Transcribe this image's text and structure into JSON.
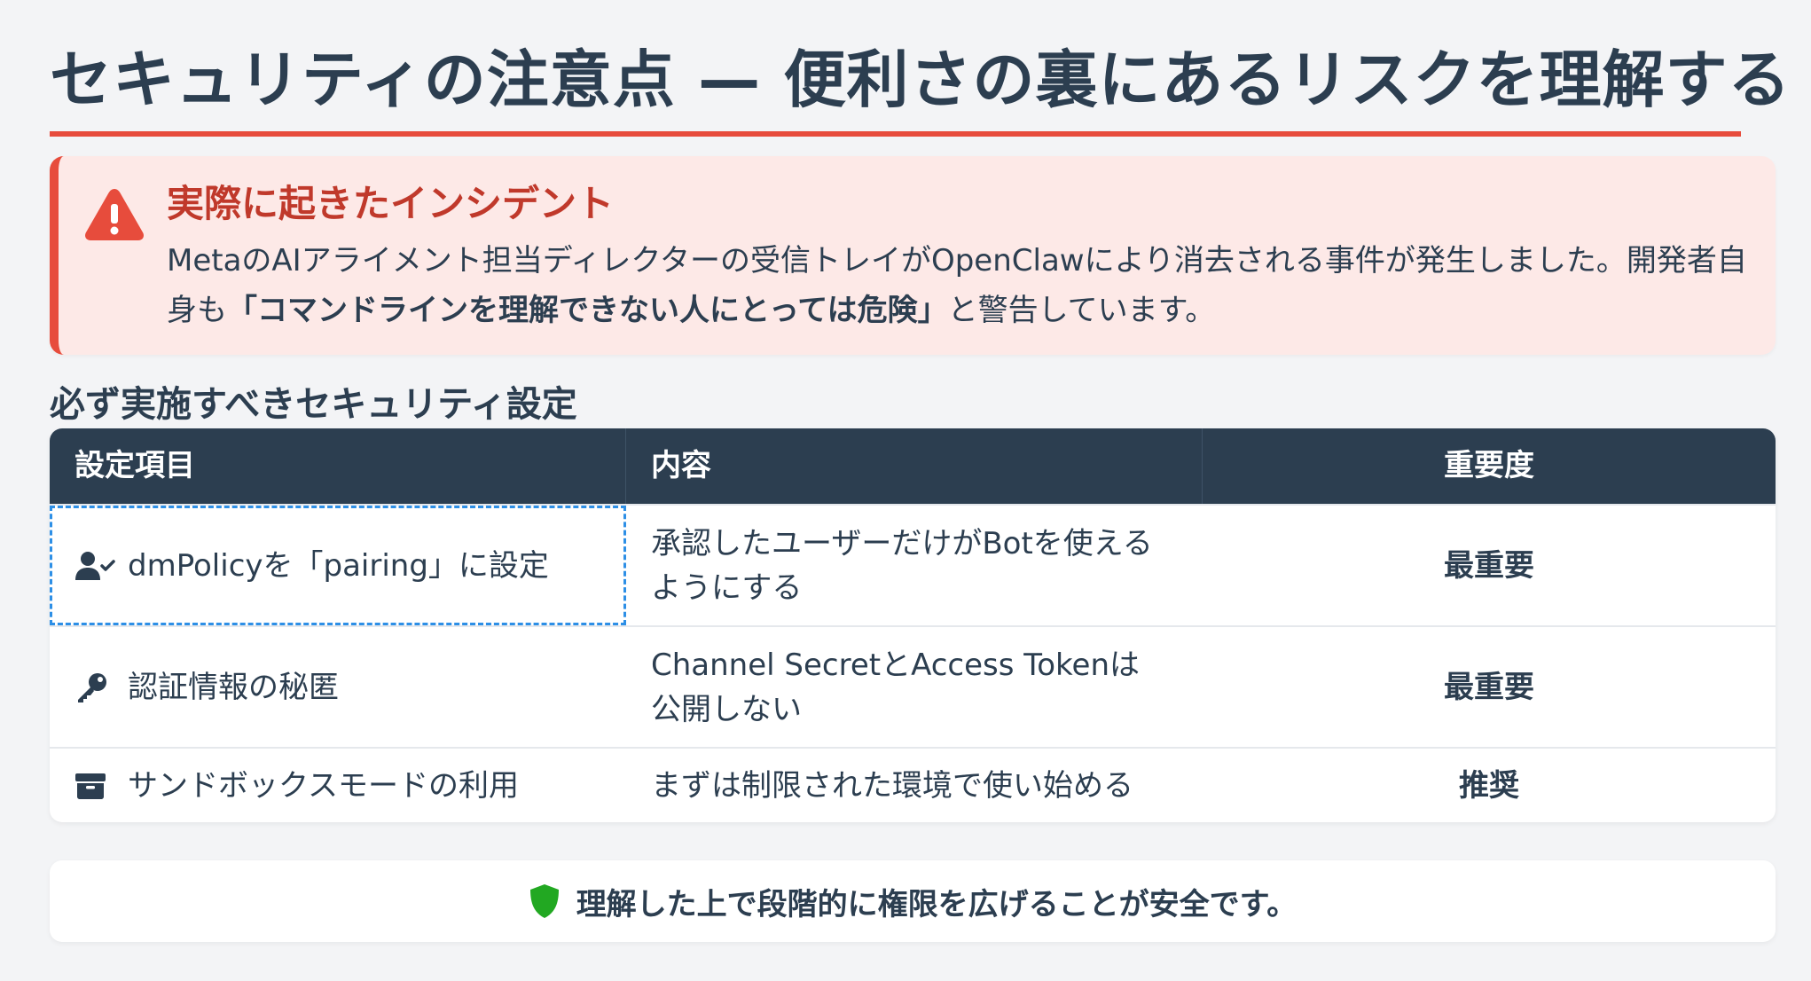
{
  "header": {
    "title": "セキュリティの注意点 — 便利さの裏にあるリスクを理解する"
  },
  "alert": {
    "icon": "warning-triangle-icon",
    "title": "実際に起きたインシデント",
    "body_before": "MetaのAIアライメント担当ディレクターの受信トレイがOpenClawにより消去される事件が発生しました。開発者自身も",
    "body_bold": "「コマンドラインを理解できない人にとっては危険」",
    "body_after": "と警告しています。",
    "color": "#e74c3c"
  },
  "section": {
    "title": "必ず実施すべきセキュリティ設定"
  },
  "table": {
    "headers": [
      "設定項目",
      "内容",
      "重要度"
    ],
    "rows": [
      {
        "icon": "user-check-icon",
        "item": "dmPolicyを「pairing」に設定",
        "content": "承認したユーザーだけがBotを使えるようにする",
        "importance": "最重要"
      },
      {
        "icon": "key-icon",
        "item": "認証情報の秘匿",
        "content": "Channel SecretとAccess Tokenは公開しない",
        "importance": "最重要"
      },
      {
        "icon": "box-icon",
        "item": "サンドボックスモードの利用",
        "content": "まずは制限された環境で使い始める",
        "importance": "推奨"
      }
    ]
  },
  "note": {
    "icon": "shield-icon",
    "text": "理解した上で段階的に権限を広げることが安全です。",
    "icon_color": "#22a822"
  }
}
